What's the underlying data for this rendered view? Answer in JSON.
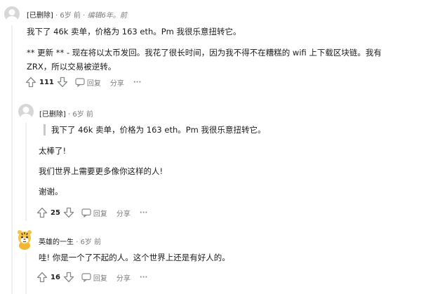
{
  "comments": [
    {
      "author": "[已删除]",
      "time": "6岁 前",
      "edited": "编辑6年。前",
      "paragraphs": [
        "我下了 46k 卖单，价格为 163 eth。Pm 我很乐意扭转它。",
        "** 更新 ** - 现在将以太币发回。我花了很长时间，因为我不得不在糟糕的 wifi 上下载区块链。我有",
        "ZRX，所以交易被逆转。"
      ],
      "score": "111",
      "reply_label": "回复",
      "share_label": "分享",
      "more_label": "···"
    },
    {
      "author": "[已删除]",
      "time": "6岁 前",
      "quote": "我下了 46k 卖单，价格为 163 eth。Pm 我很乐意扭转它。",
      "paragraphs": [
        "太棒了!",
        "我们世界上需要更多像你这样的人!",
        "谢谢。"
      ],
      "score": "25",
      "reply_label": "回复",
      "share_label": "分享",
      "more_label": "···"
    },
    {
      "author": "英雄的一生",
      "time": "6岁 前",
      "paragraphs": [
        "哇! 你是一个了不起的人。这个世界上还是有好人的。"
      ],
      "score": "16",
      "reply_label": "回复",
      "share_label": "分享",
      "more_label": "···"
    }
  ],
  "separator": "·"
}
